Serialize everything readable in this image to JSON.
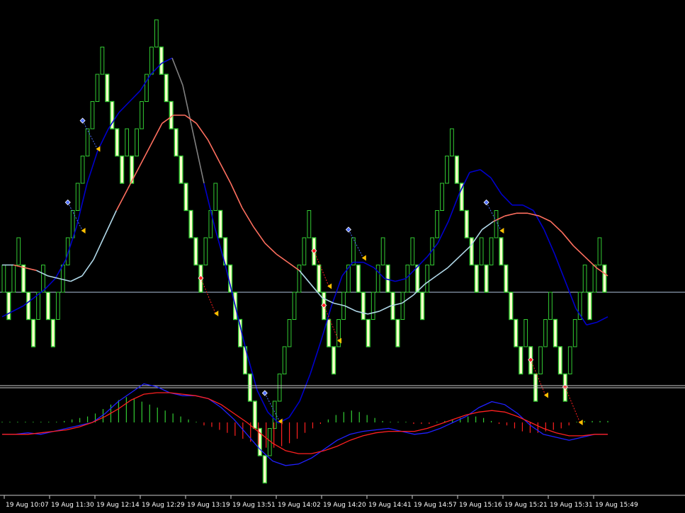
{
  "chart_data": [
    {
      "type": "renko",
      "panel": "main",
      "colors": {
        "background": "#000000",
        "up_brick": "#000000",
        "up_outline": "#33cc33",
        "down_brick": "#ffffcc",
        "down_outline": "#33cc33",
        "current_price_line": "#b0c4de",
        "fast_ma": "#0000cc",
        "slow_ma": "#b0d8e8",
        "ma_up_slope": "#808080",
        "ma_down_slope": "#ff6f5f",
        "buy_arrow": "#4f6fff",
        "sell_arrow": "#ff2020",
        "close_marker": "#ffc000"
      },
      "bricks": [
        {
          "dir": "up",
          "level": 0
        },
        {
          "dir": "down",
          "level": 0
        },
        {
          "dir": "up",
          "level": 0
        },
        {
          "dir": "up",
          "level": 1
        },
        {
          "dir": "down",
          "level": 1
        },
        {
          "dir": "down",
          "level": 0
        },
        {
          "dir": "down",
          "level": -1
        },
        {
          "dir": "up",
          "level": -1
        },
        {
          "dir": "up",
          "level": 0
        },
        {
          "dir": "down",
          "level": 0
        },
        {
          "dir": "down",
          "level": -1
        },
        {
          "dir": "up",
          "level": -1
        },
        {
          "dir": "up",
          "level": 0
        },
        {
          "dir": "up",
          "level": 1
        },
        {
          "dir": "up",
          "level": 2
        },
        {
          "dir": "up",
          "level": 3
        },
        {
          "dir": "up",
          "level": 4
        },
        {
          "dir": "up",
          "level": 5
        },
        {
          "dir": "up",
          "level": 6
        },
        {
          "dir": "up",
          "level": 7
        },
        {
          "dir": "up",
          "level": 8
        },
        {
          "dir": "down",
          "level": 8
        },
        {
          "dir": "down",
          "level": 7
        },
        {
          "dir": "down",
          "level": 6
        },
        {
          "dir": "down",
          "level": 5
        },
        {
          "dir": "up",
          "level": 5
        },
        {
          "dir": "down",
          "level": 5
        },
        {
          "dir": "up",
          "level": 5
        },
        {
          "dir": "up",
          "level": 6
        },
        {
          "dir": "up",
          "level": 7
        },
        {
          "dir": "up",
          "level": 8
        },
        {
          "dir": "up",
          "level": 9
        },
        {
          "dir": "down",
          "level": 9
        },
        {
          "dir": "down",
          "level": 8
        },
        {
          "dir": "down",
          "level": 7
        },
        {
          "dir": "down",
          "level": 6
        },
        {
          "dir": "down",
          "level": 5
        },
        {
          "dir": "down",
          "level": 4
        },
        {
          "dir": "down",
          "level": 3
        },
        {
          "dir": "down",
          "level": 2
        },
        {
          "dir": "down",
          "level": 1
        },
        {
          "dir": "up",
          "level": 1
        },
        {
          "dir": "up",
          "level": 2
        },
        {
          "dir": "up",
          "level": 3
        },
        {
          "dir": "down",
          "level": 3
        },
        {
          "dir": "down",
          "level": 2
        },
        {
          "dir": "down",
          "level": 1
        },
        {
          "dir": "down",
          "level": 0
        },
        {
          "dir": "down",
          "level": -1
        },
        {
          "dir": "down",
          "level": -2
        },
        {
          "dir": "down",
          "level": -3
        },
        {
          "dir": "down",
          "level": -4
        },
        {
          "dir": "down",
          "level": -5
        },
        {
          "dir": "down",
          "level": -6
        },
        {
          "dir": "up",
          "level": -6
        },
        {
          "dir": "up",
          "level": -5
        },
        {
          "dir": "up",
          "level": -4
        },
        {
          "dir": "up",
          "level": -3
        },
        {
          "dir": "up",
          "level": -2
        },
        {
          "dir": "up",
          "level": -1
        },
        {
          "dir": "up",
          "level": 0
        },
        {
          "dir": "up",
          "level": 1
        },
        {
          "dir": "up",
          "level": 2
        },
        {
          "dir": "down",
          "level": 2
        },
        {
          "dir": "down",
          "level": 1
        },
        {
          "dir": "down",
          "level": 0
        },
        {
          "dir": "down",
          "level": -1
        },
        {
          "dir": "down",
          "level": -2
        },
        {
          "dir": "up",
          "level": -2
        },
        {
          "dir": "up",
          "level": -1
        },
        {
          "dir": "up",
          "level": 0
        },
        {
          "dir": "up",
          "level": 1
        },
        {
          "dir": "down",
          "level": 1
        },
        {
          "dir": "down",
          "level": 0
        },
        {
          "dir": "down",
          "level": -1
        },
        {
          "dir": "up",
          "level": -1
        },
        {
          "dir": "up",
          "level": 0
        },
        {
          "dir": "up",
          "level": 1
        },
        {
          "dir": "down",
          "level": 1
        },
        {
          "dir": "down",
          "level": 0
        },
        {
          "dir": "down",
          "level": -1
        },
        {
          "dir": "up",
          "level": -1
        },
        {
          "dir": "up",
          "level": 0
        },
        {
          "dir": "up",
          "level": 1
        },
        {
          "dir": "down",
          "level": 1
        },
        {
          "dir": "down",
          "level": 0
        },
        {
          "dir": "up",
          "level": 0
        },
        {
          "dir": "up",
          "level": 1
        },
        {
          "dir": "up",
          "level": 2
        },
        {
          "dir": "up",
          "level": 3
        },
        {
          "dir": "up",
          "level": 4
        },
        {
          "dir": "up",
          "level": 5
        },
        {
          "dir": "down",
          "level": 5
        },
        {
          "dir": "down",
          "level": 4
        },
        {
          "dir": "down",
          "level": 3
        },
        {
          "dir": "down",
          "level": 2
        },
        {
          "dir": "down",
          "level": 1
        },
        {
          "dir": "up",
          "level": 1
        },
        {
          "dir": "down",
          "level": 1
        },
        {
          "dir": "up",
          "level": 1
        },
        {
          "dir": "up",
          "level": 2
        },
        {
          "dir": "down",
          "level": 2
        },
        {
          "dir": "down",
          "level": 1
        },
        {
          "dir": "down",
          "level": 0
        },
        {
          "dir": "down",
          "level": -1
        },
        {
          "dir": "down",
          "level": -2
        },
        {
          "dir": "up",
          "level": -2
        },
        {
          "dir": "down",
          "level": -2
        },
        {
          "dir": "down",
          "level": -3
        },
        {
          "dir": "up",
          "level": -3
        },
        {
          "dir": "up",
          "level": -2
        },
        {
          "dir": "up",
          "level": -1
        },
        {
          "dir": "down",
          "level": -1
        },
        {
          "dir": "down",
          "level": -2
        },
        {
          "dir": "down",
          "level": -3
        },
        {
          "dir": "up",
          "level": -3
        },
        {
          "dir": "up",
          "level": -2
        },
        {
          "dir": "up",
          "level": -1
        },
        {
          "dir": "up",
          "level": 0
        },
        {
          "dir": "down",
          "level": 0
        },
        {
          "dir": "up",
          "level": 0
        },
        {
          "dir": "up",
          "level": 1
        },
        {
          "dir": "down",
          "level": 1
        }
      ],
      "fast_ma": [
        -0.9,
        -0.7,
        -0.5,
        -0.2,
        0.1,
        0.5,
        1.2,
        2.4,
        4.0,
        5.2,
        6.0,
        6.6,
        7.0,
        7.4,
        8.0,
        8.4,
        8.6,
        7.6,
        5.8,
        4.0,
        2.4,
        1.0,
        -0.6,
        -2.2,
        -3.6,
        -4.4,
        -4.8,
        -4.6,
        -4.0,
        -3.0,
        -1.8,
        -0.5,
        0.6,
        1.1,
        1.1,
        0.9,
        0.5,
        0.4,
        0.5,
        0.9,
        1.3,
        1.8,
        2.6,
        3.6,
        4.4,
        4.5,
        4.2,
        3.6,
        3.2,
        3.2,
        3.0,
        2.3,
        1.4,
        0.4,
        -0.6,
        -1.2,
        -1.1,
        -0.9
      ],
      "slow_ma": [
        1.0,
        1.0,
        0.9,
        0.8,
        0.6,
        0.5,
        0.4,
        0.6,
        1.2,
        2.1,
        3.0,
        3.8,
        4.6,
        5.4,
        6.2,
        6.5,
        6.5,
        6.2,
        5.6,
        4.8,
        4.0,
        3.1,
        2.4,
        1.8,
        1.4,
        1.1,
        0.8,
        0.3,
        -0.2,
        -0.4,
        -0.5,
        -0.7,
        -0.8,
        -0.7,
        -0.5,
        -0.4,
        -0.1,
        0.3,
        0.6,
        0.9,
        1.3,
        1.7,
        2.3,
        2.6,
        2.8,
        2.9,
        2.9,
        2.8,
        2.6,
        2.2,
        1.7,
        1.3,
        0.9,
        0.6
      ],
      "current_level": 0,
      "signals": [
        {
          "type": "buy",
          "brick": 13
        },
        {
          "type": "buy",
          "brick": 16
        },
        {
          "type": "sell",
          "brick": 40
        },
        {
          "type": "buy",
          "brick": 53
        },
        {
          "type": "sell",
          "brick": 63
        },
        {
          "type": "sell",
          "brick": 65
        },
        {
          "type": "buy",
          "brick": 70
        },
        {
          "type": "buy",
          "brick": 98
        },
        {
          "type": "sell",
          "brick": 107
        },
        {
          "type": "sell",
          "brick": 114
        }
      ]
    },
    {
      "type": "macd",
      "panel": "indicator",
      "histogram": [
        0,
        0,
        0,
        0,
        0,
        0,
        0,
        0,
        0.05,
        0.1,
        0.15,
        0.2,
        0.3,
        0.45,
        0.6,
        0.75,
        0.85,
        0.8,
        0.7,
        0.6,
        0.5,
        0.4,
        0.3,
        0.2,
        0.1,
        0,
        -0.1,
        -0.15,
        -0.25,
        -0.35,
        -0.45,
        -0.55,
        -0.65,
        -0.75,
        -0.85,
        -0.85,
        -0.8,
        -0.7,
        -0.55,
        -0.35,
        -0.2,
        -0.05,
        0.1,
        0.25,
        0.35,
        0.4,
        0.35,
        0.25,
        0.15,
        0.05,
        0,
        0,
        0,
        -0.05,
        -0.05,
        -0.05,
        0,
        0.05,
        0.1,
        0.15,
        0.2,
        0.2,
        0.15,
        0.05,
        -0.05,
        -0.1,
        -0.2,
        -0.3,
        -0.35,
        -0.35,
        -0.3,
        -0.25,
        -0.2,
        -0.1,
        0,
        0.05,
        0.05,
        0.05,
        0.05
      ],
      "main_line": [
        -0.4,
        -0.4,
        -0.35,
        -0.4,
        -0.3,
        -0.2,
        -0.1,
        0,
        0.3,
        0.7,
        1.0,
        1.3,
        1.2,
        1.0,
        0.9,
        0.9,
        0.8,
        0.5,
        0.1,
        -0.4,
        -0.9,
        -1.3,
        -1.45,
        -1.4,
        -1.2,
        -0.9,
        -0.6,
        -0.4,
        -0.3,
        -0.25,
        -0.2,
        -0.3,
        -0.4,
        -0.35,
        -0.2,
        0,
        0.2,
        0.5,
        0.7,
        0.6,
        0.3,
        -0.1,
        -0.4,
        -0.5,
        -0.6,
        -0.5,
        -0.4,
        -0.4
      ],
      "signal_line": [
        -0.4,
        -0.4,
        -0.4,
        -0.35,
        -0.3,
        -0.25,
        -0.15,
        0,
        0.2,
        0.45,
        0.75,
        0.95,
        1.0,
        1.0,
        0.95,
        0.9,
        0.8,
        0.6,
        0.3,
        0,
        -0.35,
        -0.7,
        -0.95,
        -1.05,
        -1.05,
        -0.95,
        -0.8,
        -0.6,
        -0.45,
        -0.35,
        -0.3,
        -0.3,
        -0.3,
        -0.2,
        -0.05,
        0.1,
        0.25,
        0.35,
        0.4,
        0.35,
        0.2,
        0,
        -0.2,
        -0.35,
        -0.45,
        -0.45,
        -0.4,
        -0.4
      ],
      "colors": {
        "hist_up": "#33cc33",
        "hist_down": "#ff2020",
        "main": "#2020ff",
        "signal": "#ff2020"
      }
    }
  ],
  "time_axis": {
    "labels": [
      "19 Aug 10:07",
      "19 Aug 11:30",
      "19 Aug 12:14",
      "19 Aug 12:29",
      "19 Aug 13:19",
      "19 Aug 13:51",
      "19 Aug 14:02",
      "19 Aug 14:20",
      "19 Aug 14:41",
      "19 Aug 14:57",
      "19 Aug 15:16",
      "19 Aug 15:21",
      "19 Aug 15:31",
      "19 Aug 15:49"
    ]
  }
}
